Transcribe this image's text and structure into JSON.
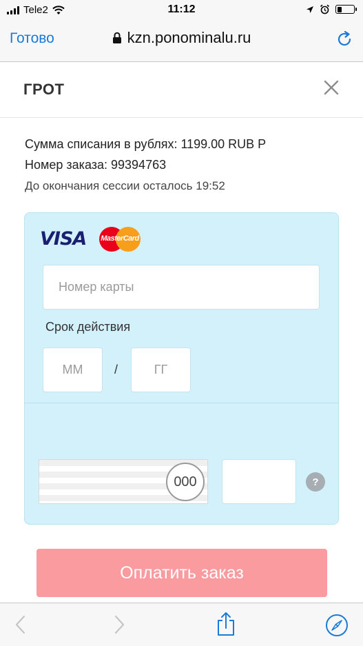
{
  "status_bar": {
    "carrier": "Tele2",
    "time": "11:12",
    "battery_level": 0.3
  },
  "browser": {
    "done_label": "Готово",
    "url": "kzn.ponominalu.ru",
    "accent_color": "#1a7ad8"
  },
  "modal": {
    "title": "ГРОТ"
  },
  "order": {
    "amount_line": "Сумма списания в рублях: 1199.00 RUB Р",
    "order_line": "Номер заказа: 99394763",
    "session_line": "До окончания сессии осталось 19:52"
  },
  "card_form": {
    "visa_label": "VISA",
    "mastercard_label": "MasterCard",
    "card_number_placeholder": "Номер карты",
    "expiry_label": "Срок действия",
    "month_placeholder": "ММ",
    "separator": "/",
    "year_placeholder": "ГГ",
    "cvc_hint": "000",
    "help_label": "?",
    "panel_color": "#d2f1fa"
  },
  "pay_button": {
    "label": "Оплатить заказ",
    "color": "#f99b9f"
  },
  "toolbar": {
    "icons": [
      "back-icon",
      "forward-icon",
      "share-icon",
      "compass-icon"
    ]
  }
}
